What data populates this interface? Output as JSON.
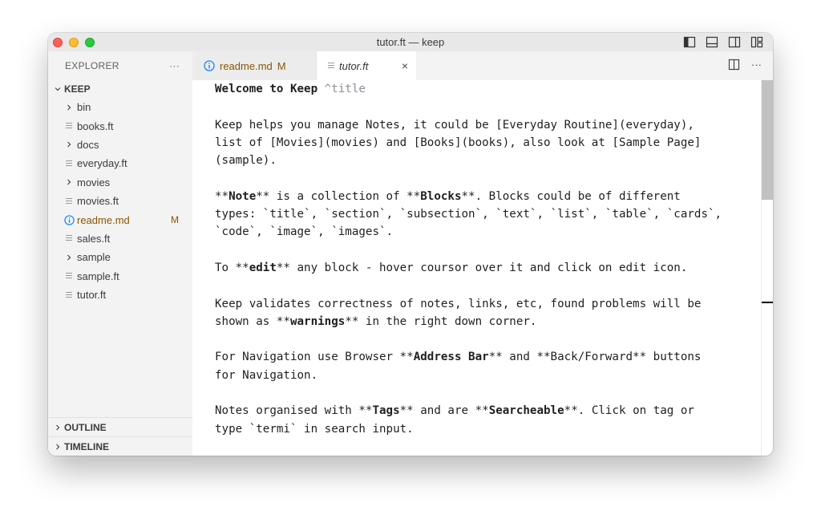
{
  "window": {
    "title": "tutor.ft — keep"
  },
  "sidebar": {
    "header": "EXPLORER",
    "more": "···",
    "root": "KEEP",
    "items": [
      {
        "type": "folder",
        "label": "bin"
      },
      {
        "type": "file",
        "label": "books.ft"
      },
      {
        "type": "folder",
        "label": "docs"
      },
      {
        "type": "file",
        "label": "everyday.ft"
      },
      {
        "type": "folder",
        "label": "movies"
      },
      {
        "type": "file",
        "label": "movies.ft"
      },
      {
        "type": "file-info",
        "label": "readme.md",
        "badge": "M"
      },
      {
        "type": "file",
        "label": "sales.ft"
      },
      {
        "type": "folder",
        "label": "sample"
      },
      {
        "type": "file",
        "label": "sample.ft"
      },
      {
        "type": "file",
        "label": "tutor.ft"
      }
    ],
    "outline": "OUTLINE",
    "timeline": "TIMELINE"
  },
  "tabs": [
    {
      "label": "readme.md",
      "badge": "M"
    },
    {
      "label": "tutor.ft",
      "close": "×"
    }
  ],
  "tab_actions": {
    "more": "···"
  },
  "editor": {
    "lines": [
      [
        {
          "t": "Welcome to Keep ",
          "s": "b"
        },
        {
          "t": "^title",
          "s": "muted"
        }
      ],
      [],
      [
        {
          "t": "Keep helps you manage Notes, it could be [Everyday Routine](everyday),"
        }
      ],
      [
        {
          "t": "list of [Movies](movies) and [Books](books), also look at [Sample Page]"
        }
      ],
      [
        {
          "t": "(sample)."
        }
      ],
      [],
      [
        {
          "t": "**"
        },
        {
          "t": "Note",
          "s": "b"
        },
        {
          "t": "** is a collection of **"
        },
        {
          "t": "Blocks",
          "s": "b"
        },
        {
          "t": "**. Blocks could be of different"
        }
      ],
      [
        {
          "t": "types: `title`, `section`, `subsection`, `text`, `list`, `table`, `cards`,"
        }
      ],
      [
        {
          "t": "`code`, `image`, `images`."
        }
      ],
      [],
      [
        {
          "t": "To **"
        },
        {
          "t": "edit",
          "s": "b"
        },
        {
          "t": "** any block - hover coursor over it and click on edit icon."
        }
      ],
      [],
      [
        {
          "t": "Keep validates correctness of notes, links, etc, found problems will be"
        }
      ],
      [
        {
          "t": "shown as **"
        },
        {
          "t": "warnings",
          "s": "b"
        },
        {
          "t": "** in the right down corner."
        }
      ],
      [],
      [
        {
          "t": "For Navigation use Browser **"
        },
        {
          "t": "Address Bar",
          "s": "b"
        },
        {
          "t": "** and **Back/Forward** buttons"
        }
      ],
      [
        {
          "t": "for Navigation."
        }
      ],
      [],
      [
        {
          "t": "Notes organised with **"
        },
        {
          "t": "Tags",
          "s": "b"
        },
        {
          "t": "** and are **"
        },
        {
          "t": "Searcheable",
          "s": "b"
        },
        {
          "t": "**. Click on tag or"
        }
      ],
      [
        {
          "t": "type `termi` in search input."
        }
      ]
    ]
  },
  "colors": {
    "modified": "#895503",
    "info_icon": "#1a85ff",
    "titlebar": "#e8e8e8"
  }
}
